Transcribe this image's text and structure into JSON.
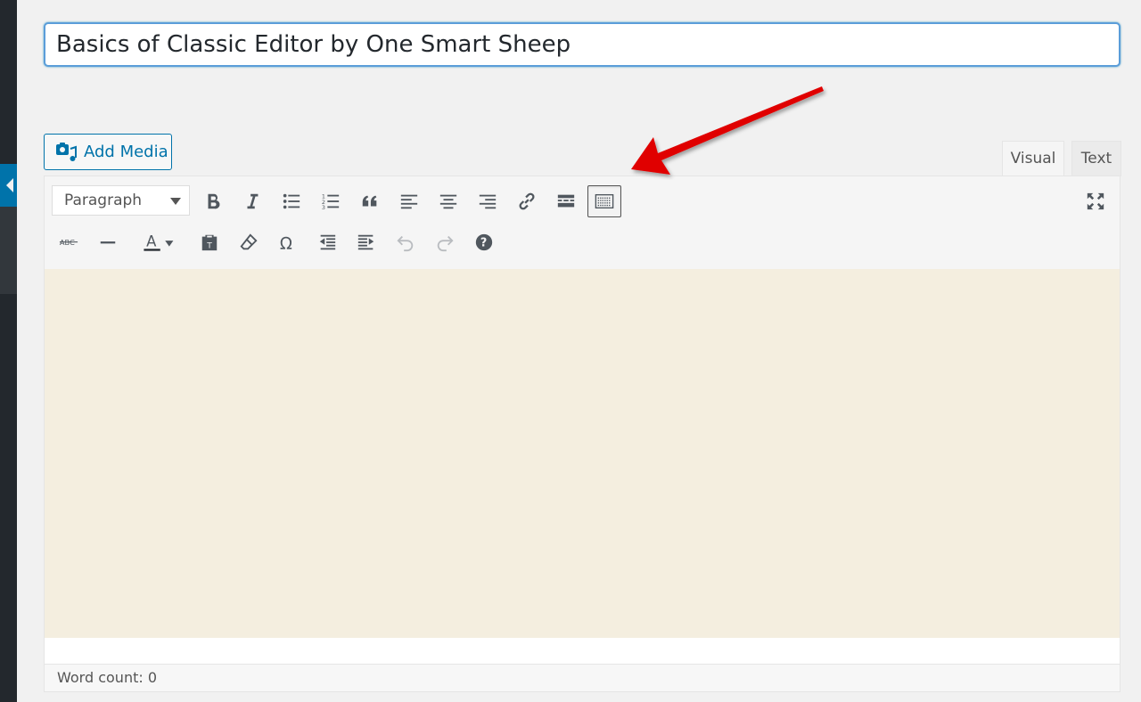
{
  "post": {
    "title": "Basics of Classic Editor by One Smart Sheep"
  },
  "media": {
    "add_media_label": "Add Media"
  },
  "tabs": {
    "visual": "Visual",
    "text": "Text",
    "active": "visual"
  },
  "toolbar": {
    "format_select_value": "Paragraph",
    "row1_icons": [
      "bold-icon",
      "italic-icon",
      "bulleted-list-icon",
      "numbered-list-icon",
      "blockquote-icon",
      "align-left-icon",
      "align-center-icon",
      "align-right-icon",
      "link-icon",
      "read-more-icon",
      "toolbar-toggle-icon"
    ],
    "row2_icons": [
      "strikethrough-icon",
      "horizontal-line-icon",
      "text-color-icon",
      "paste-as-text-icon",
      "clear-formatting-icon",
      "special-character-icon",
      "outdent-icon",
      "indent-icon",
      "undo-icon",
      "redo-icon",
      "help-icon"
    ],
    "fullscreen_icon": "fullscreen-icon",
    "active_button": "toolbar-toggle",
    "strikethrough_glyph": "ABC",
    "text_color_glyph": "A",
    "omega_glyph": "Ω",
    "help_glyph": "?"
  },
  "status": {
    "word_count_label": "Word count: 0"
  },
  "colors": {
    "accent": "#0073aa",
    "content_bg": "#f4eedf",
    "annotation_arrow": "#e00000"
  }
}
